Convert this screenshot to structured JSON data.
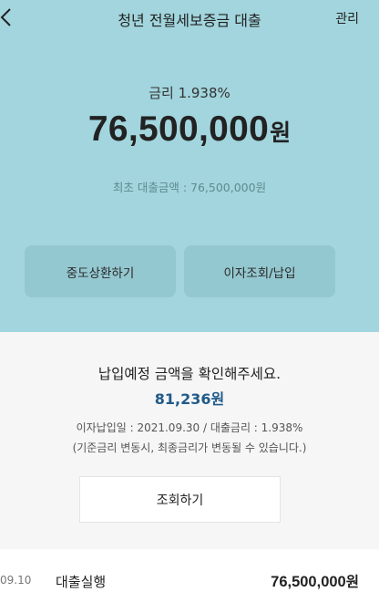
{
  "header": {
    "title": "청년 전월세보증금 대출",
    "manage_label": "관리"
  },
  "summary": {
    "rate_text": "금리 1.938%",
    "amount": "76,500,000",
    "amount_unit": "원",
    "initial_amount_text": "최초 대출금액 : 76,500,000원"
  },
  "actions": {
    "early_repay_label": "중도상환하기",
    "interest_label": "이자조회/납입"
  },
  "payment": {
    "title": "납입예정 금액을 확인해주세요.",
    "amount": "81,236원",
    "info": "이자납입일 : 2021.09.30 / 대출금리 : 1.938%",
    "note": "(기준금리 변동시, 최종금리가 변동될 수 있습니다.)",
    "query_label": "조회하기"
  },
  "transactions": [
    {
      "date": "09.10",
      "label": "대출실행",
      "amount": "76,500,000",
      "unit": "원"
    }
  ],
  "colors": {
    "header_bg": "#a2d5dd",
    "button_bg": "#94c8d0",
    "accent_amount": "#1f5a8a"
  }
}
